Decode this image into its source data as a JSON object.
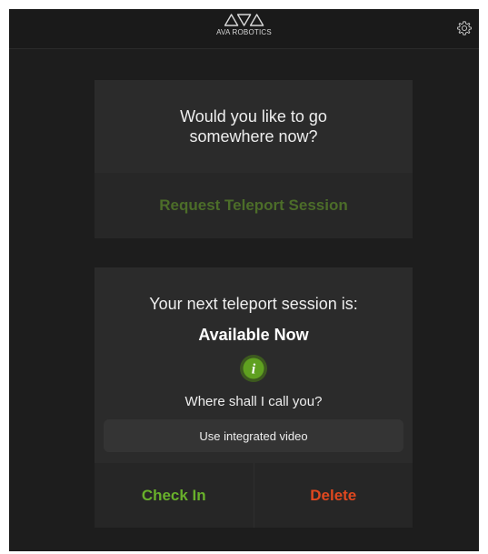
{
  "header": {
    "logo_text": "AVA ROBOTICS",
    "settings_icon": "gear-icon"
  },
  "request_card": {
    "prompt": "Would you like to go\nsomewhere now?",
    "request_label": "Request Teleport Session"
  },
  "session_card": {
    "next_label": "Your next teleport session is:",
    "next_value": "Available Now",
    "info_icon": "info-icon",
    "call_label": "Where shall I call you?",
    "call_option": "Use integrated video",
    "checkin_label": "Check In",
    "delete_label": "Delete"
  },
  "colors": {
    "background": "#1d1d1d",
    "card": "#2b2b2b",
    "request_green": "#4c6d29",
    "checkin_green": "#68b02b",
    "delete_orange": "#e0481f",
    "info_green": "#5fa020"
  }
}
